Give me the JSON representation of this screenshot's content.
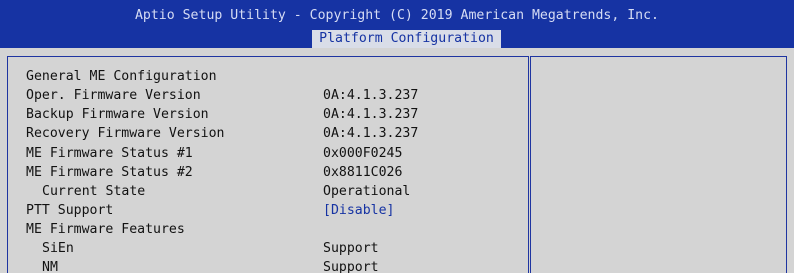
{
  "header": {
    "title": "Aptio Setup Utility - Copyright (C) 2019 American Megatrends, Inc.",
    "active_tab": "Platform Configuration"
  },
  "settings": [
    {
      "label": "General ME Configuration",
      "value": ""
    },
    {
      "label": "Oper. Firmware Version",
      "value": "0A:4.1.3.237"
    },
    {
      "label": "Backup Firmware Version",
      "value": "0A:4.1.3.237"
    },
    {
      "label": "Recovery Firmware Version",
      "value": "0A:4.1.3.237"
    },
    {
      "label": "ME Firmware Status #1",
      "value": "0x000F0245"
    },
    {
      "label": "ME Firmware Status #2",
      "value": "0x8811C026"
    },
    {
      "label": "Current State",
      "value": "Operational"
    },
    {
      "label": "PTT Support",
      "value": "[Disable]"
    },
    {
      "label": "ME Firmware Features",
      "value": ""
    },
    {
      "label": "SiEn",
      "value": "Support"
    },
    {
      "label": "NM",
      "value": "Support"
    }
  ],
  "colors": {
    "background": "#1633a3",
    "panel": "#d4d4d4",
    "text": "#121212",
    "link": "#1633a3"
  }
}
